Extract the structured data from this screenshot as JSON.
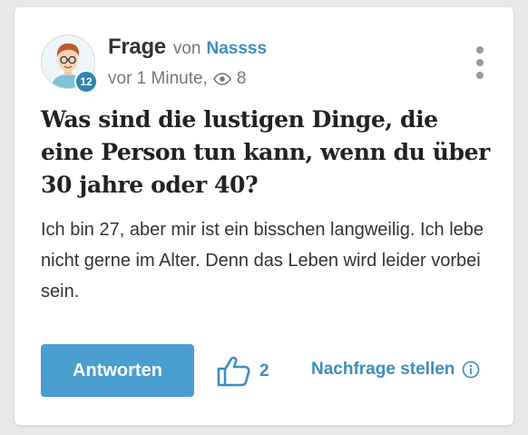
{
  "post": {
    "type_label": "Frage",
    "by_label": "von",
    "author": "Nassss",
    "author_rank": "12",
    "time_label": "vor 1 Minute,",
    "views": "8",
    "title": "Was sind die lustigen Dinge, die eine Person tun kann, wenn du über 30 jahre oder 40?",
    "body": "Ich bin 27, aber mir ist ein bisschen langweilig. Ich lebe nicht gerne im Alter. Denn das Leben wird leider vorbei sein."
  },
  "actions": {
    "answer_label": "Antworten",
    "like_count": "2",
    "follow_up_label": "Nachfrage stellen"
  },
  "icons": {
    "views": "eye-icon",
    "like": "thumbs-up-icon",
    "info": "info-icon",
    "menu": "kebab-menu-icon"
  },
  "colors": {
    "accent": "#4a9fd0",
    "link": "#3c8fbf",
    "badge": "#2f86b3"
  }
}
